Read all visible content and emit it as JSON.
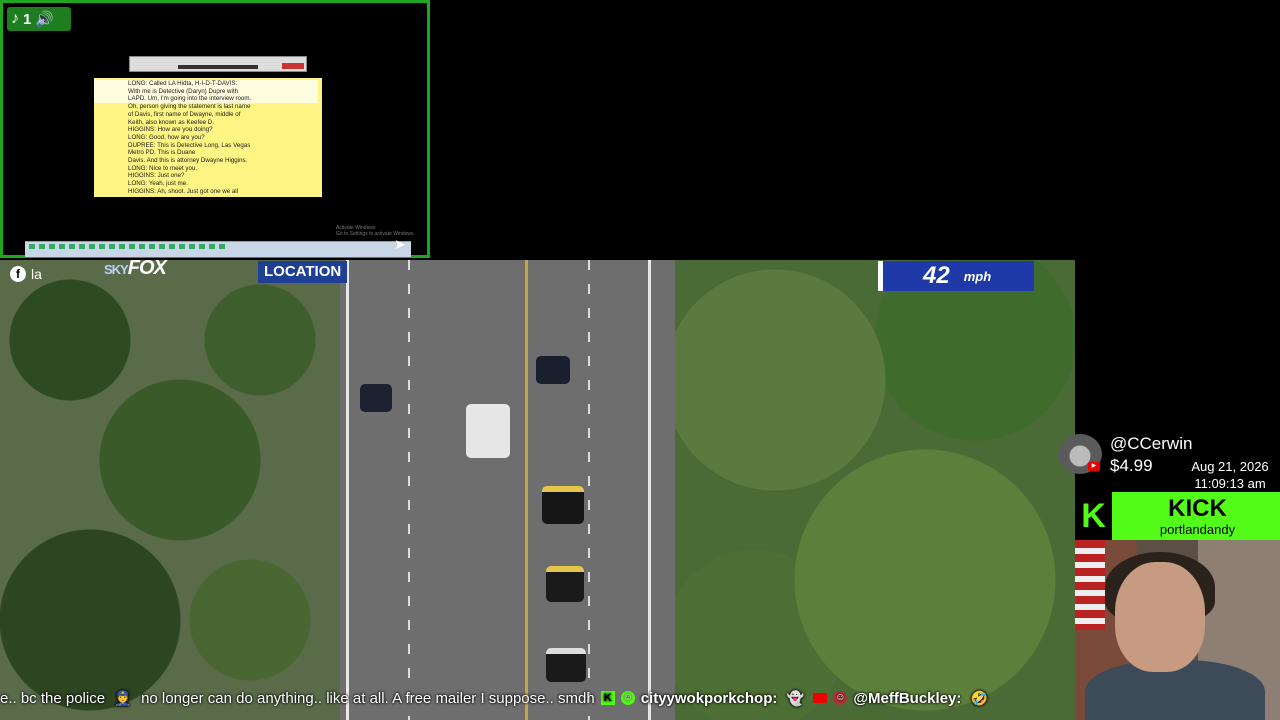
{
  "tiktok": {
    "count": "1",
    "icon": "tiktok-icon",
    "speaker_icon": "speaker-icon"
  },
  "transcript_lines": [
    "LONG:  Called LA Hidta, H-I-D-T-DAVIS:",
    "With me is Detective (Daryn) Dupre with",
    "LAPD.  Um, I'm going into the interview room.",
    "Oh, person giving the statement is last name",
    "of Davis, first name of Dwayne, middle of",
    "Keith, also known as Keefee D.",
    "HIGGINS: How are you doing?",
    "LONG: Good, how are you?",
    "DUPREE: This is Detective Long, Las Vegas",
    "Metro PD.  This is Duane",
    "Davis.  And this is attorney Dwayne Higgins.",
    "LONG:  Nice to meet you.",
    "HIGGINS: Just one?",
    "LONG: Yeah, just me.",
    "HIGGINS: Ah, shoot.  Just got one we all"
  ],
  "windows_note": [
    "Activate Windows",
    "Go to Settings to activate Windows."
  ],
  "feed": {
    "facebook_label": "la",
    "logo_sky": "SKY",
    "logo_fox": "FOX",
    "location_label": "LOCATION",
    "speed_value": "42",
    "speed_unit": "mph"
  },
  "donation": {
    "user": "@CCerwin",
    "amount": "$4.99"
  },
  "datetime": {
    "date": "Aug 21, 2026",
    "time": "11:09:13 am"
  },
  "kick": {
    "brand": "KICK",
    "channel": "portlandandy"
  },
  "ticker": {
    "text1": "e.. bc the police",
    "text2": "no longer can do anything.. like at all. A free mailer I suppose.. smdh",
    "user1": "cityywokporkchop:",
    "user2": "@MeffBuckley:"
  },
  "colors": {
    "kick_green": "#53fc18",
    "speed_blue": "#1f3aa8",
    "location_blue": "#1f3f95",
    "transcript_yellow": "#fff585",
    "border_green": "#1fa51f"
  }
}
